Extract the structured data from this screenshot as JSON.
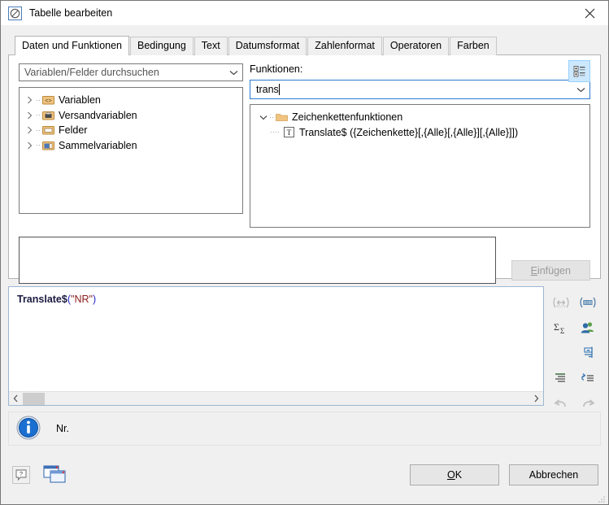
{
  "window": {
    "title": "Tabelle bearbeiten",
    "title_icon": "table-edit-icon",
    "close_icon": "close-icon"
  },
  "tabs": [
    {
      "label": "Daten und Funktionen",
      "active": true
    },
    {
      "label": "Bedingung",
      "active": false
    },
    {
      "label": "Text",
      "active": false
    },
    {
      "label": "Datumsformat",
      "active": false
    },
    {
      "label": "Zahlenformat",
      "active": false
    },
    {
      "label": "Operatoren",
      "active": false
    },
    {
      "label": "Farben",
      "active": false
    }
  ],
  "variables_pane": {
    "search_combo_value": "Variablen/Felder durchsuchen",
    "chevron_icon": "chevron-down-icon",
    "tree": [
      {
        "label": "Variablen",
        "icon": "angle-brackets-folder-icon",
        "expander": "chevron-right-icon"
      },
      {
        "label": "Versandvariablen",
        "icon": "printer-folder-icon",
        "expander": "chevron-right-icon"
      },
      {
        "label": "Felder",
        "icon": "field-folder-icon",
        "expander": "chevron-right-icon"
      },
      {
        "label": "Sammelvariablen",
        "icon": "collection-folder-icon",
        "expander": "chevron-right-icon"
      }
    ]
  },
  "functions_pane": {
    "label": "Funktionen:",
    "search_value": "trans",
    "search_placeholder": "",
    "chevron_icon": "chevron-down-icon",
    "toolbar_button": "expand-all-icon",
    "tree": [
      {
        "label": "Zeichenkettenfunktionen",
        "icon": "folder-icon",
        "expander": "chevron-down-icon",
        "children": [
          {
            "label": "Translate$ ({Zeichenkette}[,{Alle}[,{Alle}][,{Alle}]])",
            "icon": "text-type-icon"
          }
        ]
      }
    ]
  },
  "parameter_area": {
    "value": "",
    "insert_button": {
      "label_prefix": "",
      "accel": "E",
      "label_rest": "infügen",
      "enabled": false
    }
  },
  "formula_editor": {
    "tokens": [
      {
        "text": "Translate$",
        "type": "function"
      },
      {
        "text": "(",
        "type": "paren"
      },
      {
        "text": "\"NR\"",
        "type": "string"
      },
      {
        "text": ")",
        "type": "paren"
      }
    ],
    "plain_text": "Translate$(\"NR\")",
    "scrollbar": {
      "left_arrow_icon": "chevron-left-icon",
      "right_arrow_icon": "chevron-right-icon"
    },
    "tools": [
      {
        "name": "insert-field-icon",
        "enabled": false
      },
      {
        "name": "insert-barcode-icon",
        "enabled": true
      },
      {
        "name": "sum-function-icon",
        "enabled": true
      },
      {
        "name": "users-icon",
        "enabled": true
      },
      {
        "name": "align-right-wrap-icon",
        "enabled": true
      },
      {
        "name": "indent-icon",
        "enabled": true
      },
      {
        "name": "sort-reset-icon",
        "enabled": true
      },
      {
        "name": "undo-icon",
        "enabled": false
      },
      {
        "name": "redo-icon",
        "enabled": false
      }
    ]
  },
  "status_bar": {
    "icon": "info-icon",
    "text": "Nr."
  },
  "bottom_bar": {
    "help_button": "help-icon",
    "windows_button": "cascade-windows-icon",
    "ok_button": {
      "accel": "O",
      "rest": "K"
    },
    "cancel_button": {
      "label": "Abbrechen"
    },
    "resize_grip": "resize-grip-icon"
  },
  "colors": {
    "accent_blue": "#2b7cd3",
    "selected_tool_bg": "#cce8ff",
    "string_token": "#8b1a1a",
    "paren_token": "#2727c8",
    "function_token": "#1a1a40",
    "folder_yellow": "#ecb96a",
    "info_blue": "#1b6fd0"
  }
}
